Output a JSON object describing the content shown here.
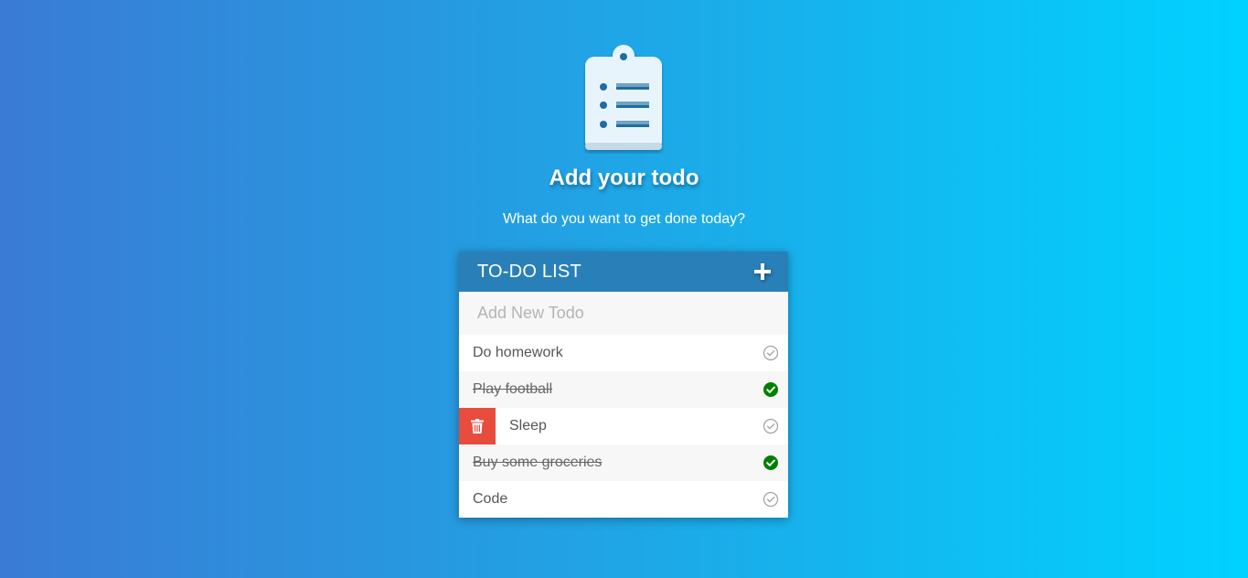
{
  "hero": {
    "title": "Add your todo",
    "subtitle": "What do you want to get done today?",
    "icon": "clipboard-list-icon"
  },
  "card": {
    "header_title": "TO-DO LIST",
    "add_icon": "plus-icon",
    "new_todo_placeholder": "Add New Todo",
    "new_todo_value": ""
  },
  "todos": [
    {
      "text": "Do homework",
      "completed": false
    },
    {
      "text": "Play football",
      "completed": true
    },
    {
      "text": "Sleep",
      "completed": false,
      "delete_revealed": true
    },
    {
      "text": "Buy some groceries",
      "completed": true
    },
    {
      "text": "Code",
      "completed": false
    }
  ],
  "colors": {
    "gradient_start": "#3a7bd5",
    "gradient_end": "#00d2ff",
    "header": "#2980b9",
    "delete": "#e74c3c",
    "check_done": "#008000",
    "check_pending": "#a0a0a0"
  }
}
